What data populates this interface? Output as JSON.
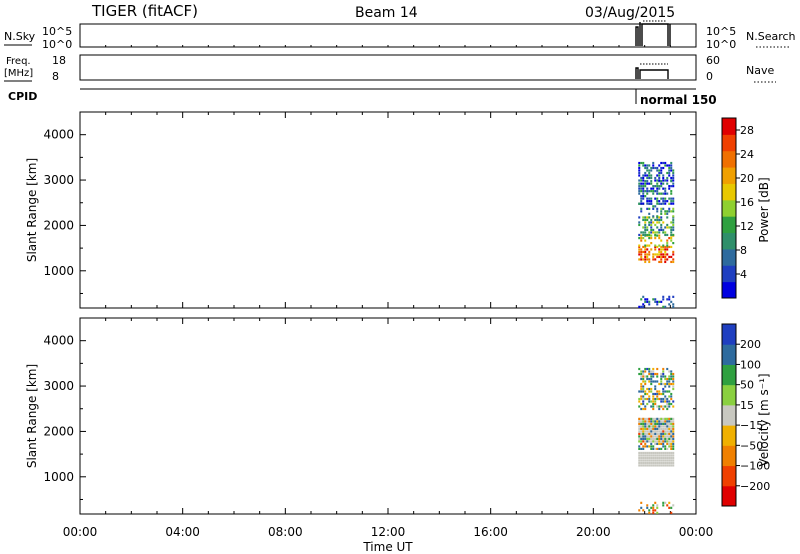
{
  "header": {
    "station": "TIGER (fitACF)",
    "beam": "Beam 14",
    "date": "03/Aug/2015"
  },
  "top_panels": {
    "nsky_label": "N.Sky",
    "nsky_ticks": [
      "10^5",
      "10^0"
    ],
    "nsearch_label": "N.Search",
    "nsearch_ticks": [
      "10^5",
      "10^0"
    ],
    "freq_label": "Freq.",
    "freq_unit": "[MHz]",
    "freq_ticks": [
      "18",
      "8"
    ],
    "nave_label": "Nave",
    "nave_ticks": [
      "60",
      "0"
    ],
    "cpid_label": "CPID",
    "cpid_value": "normal 150"
  },
  "chart_data": [
    {
      "type": "heatmap",
      "title": "",
      "ylabel": "Slant Range [km]",
      "xlabel": "",
      "xlim": [
        "00:00",
        "24:00"
      ],
      "ylim": [
        180,
        4500
      ],
      "yticks": [
        "4000",
        "3000",
        "2000",
        "1000"
      ],
      "colorbar": {
        "label": "Power [dB]",
        "ticks": [
          "28",
          "24",
          "20",
          "16",
          "12",
          "8",
          "4"
        ],
        "range": [
          0,
          30
        ],
        "colors": [
          "#0000e0",
          "#1f3fc0",
          "#2e6b9e",
          "#2f8f6a",
          "#2fa040",
          "#8fd030",
          "#e8c800",
          "#f0a000",
          "#f07000",
          "#f04000",
          "#e00000"
        ]
      },
      "data_window": {
        "start_hour": 21.75,
        "end_hour": 23.1
      },
      "echo_bands": [
        {
          "range_km": [
            1200,
            1550
          ],
          "power_db": 24
        },
        {
          "range_km": [
            1550,
            1800
          ],
          "power_db": 18
        },
        {
          "range_km": [
            1800,
            2200
          ],
          "power_db": 12
        },
        {
          "range_km": [
            2200,
            2500
          ],
          "power_db": 10
        },
        {
          "range_km": [
            2500,
            3000
          ],
          "power_db": 6
        },
        {
          "range_km": [
            3000,
            3400
          ],
          "power_db": 6
        },
        {
          "range_km": [
            200,
            450
          ],
          "power_db": 5
        }
      ]
    },
    {
      "type": "heatmap",
      "title": "",
      "ylabel": "Slant Range [km]",
      "xlabel": "Time UT",
      "xlim": [
        "00:00",
        "24:00"
      ],
      "ylim": [
        180,
        4500
      ],
      "yticks": [
        "4000",
        "3000",
        "2000",
        "1000"
      ],
      "xticks": [
        "00:00",
        "04:00",
        "08:00",
        "12:00",
        "16:00",
        "20:00",
        "00:00"
      ],
      "colorbar": {
        "label": "Velocity [m s⁻¹]",
        "ticks": [
          "200",
          "100",
          "50",
          "15",
          "−15",
          "−50",
          "−100",
          "−200"
        ],
        "colors": [
          "#e00000",
          "#f04000",
          "#f08000",
          "#f0b000",
          "#c8c8c0",
          "#8ad040",
          "#2fa040",
          "#2e6b9e",
          "#1f3fc0"
        ]
      },
      "data_window": {
        "start_hour": 21.75,
        "end_hour": 23.1
      },
      "echo_bands": [
        {
          "range_km": [
            1250,
            1550
          ],
          "class": "ground_scatter"
        },
        {
          "range_km": [
            1750,
            2300
          ],
          "class": "ground_scatter"
        },
        {
          "range_km": [
            1600,
            2300
          ],
          "velocity_ms": 40
        },
        {
          "range_km": [
            2500,
            3400
          ],
          "velocity_ms": 60
        },
        {
          "range_km": [
            200,
            450
          ],
          "velocity_ms": -30
        }
      ]
    }
  ]
}
